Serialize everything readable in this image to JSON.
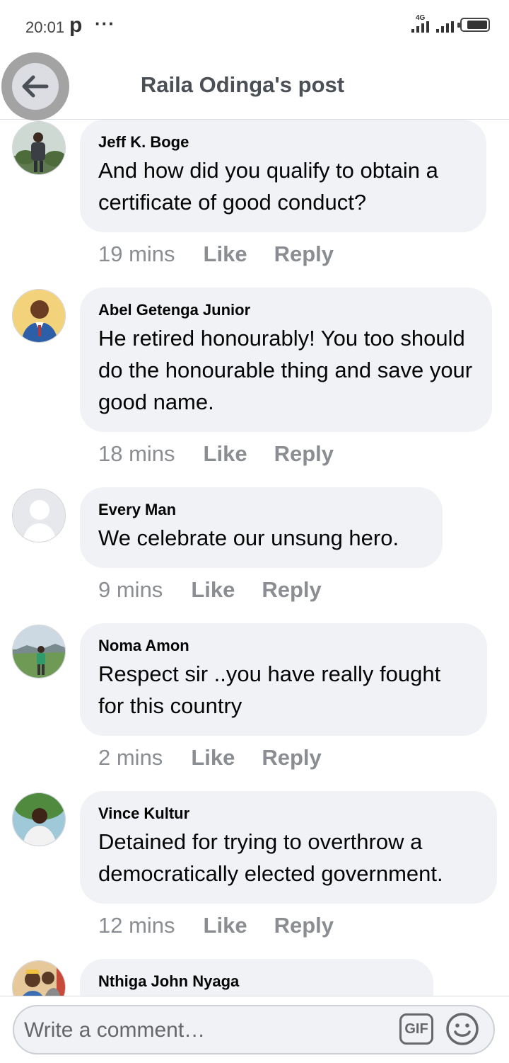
{
  "status_bar": {
    "time": "20:01",
    "app_badge": "p",
    "overflow": "···",
    "network": "4G",
    "icons": [
      "p-icon",
      "dots-icon",
      "signal-icon",
      "signal-icon",
      "battery-icon"
    ]
  },
  "header": {
    "title": "Raila Odinga's post",
    "back_icon": "arrow-left-icon"
  },
  "comments": [
    {
      "author": "Jeff K. Boge",
      "text": "And how did you qualify to obtain a certificate of good conduct?",
      "time": "19 mins",
      "like": "Like",
      "reply": "Reply"
    },
    {
      "author": "Abel Getenga Junior",
      "text": "He retired honourably! You too should do the honourable thing and save your good name.",
      "time": "18 mins",
      "like": "Like",
      "reply": "Reply"
    },
    {
      "author": "Every Man",
      "text": "We celebrate our unsung hero.",
      "time": "9 mins",
      "like": "Like",
      "reply": "Reply"
    },
    {
      "author": "Noma Amon",
      "text": "Respect sir ..you have really fought for this country",
      "time": "2 mins",
      "like": "Like",
      "reply": "Reply"
    },
    {
      "author": "Vince Kultur",
      "text": "Detained for trying to overthrow a democratically elected government.",
      "time": "12 mins",
      "like": "Like",
      "reply": "Reply"
    },
    {
      "author": "Nthiga John Nyaga",
      "text": "",
      "time": "",
      "like": "",
      "reply": ""
    }
  ],
  "composer": {
    "placeholder": "Write a comment…",
    "gif_label": "GIF",
    "emoji_icon": "smiley-icon"
  },
  "colors": {
    "bubble": "#f0f2f5",
    "secondary_text": "#8a8d91",
    "header_text": "#4b4f56"
  }
}
